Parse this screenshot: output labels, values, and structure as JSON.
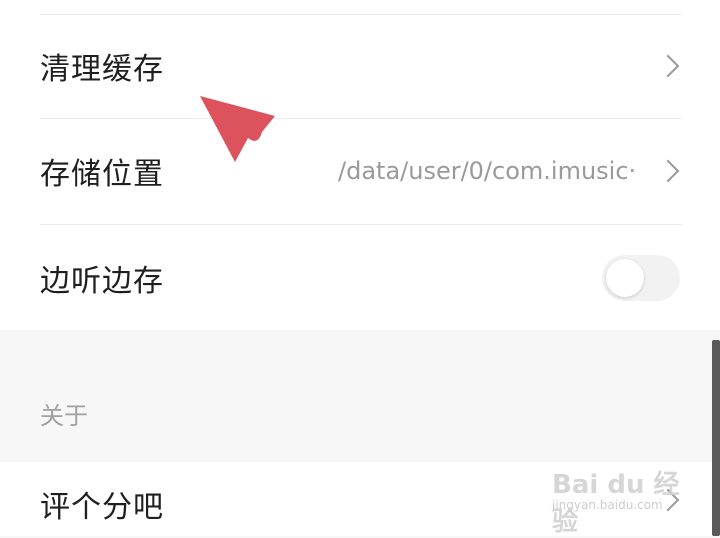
{
  "settings": {
    "rows": [
      {
        "label": "清理缓存"
      },
      {
        "label": "存储位置",
        "value": "/data/user/0/com.imusic···"
      },
      {
        "label": "边听边存",
        "toggle_on": false
      }
    ],
    "about_section": {
      "header": "关于",
      "rate_label": "评个分吧"
    }
  },
  "watermark": {
    "text": "Bai du 经验",
    "sub": "jingyan.baidu.com"
  },
  "colors": {
    "pointer": "#d9434f"
  }
}
